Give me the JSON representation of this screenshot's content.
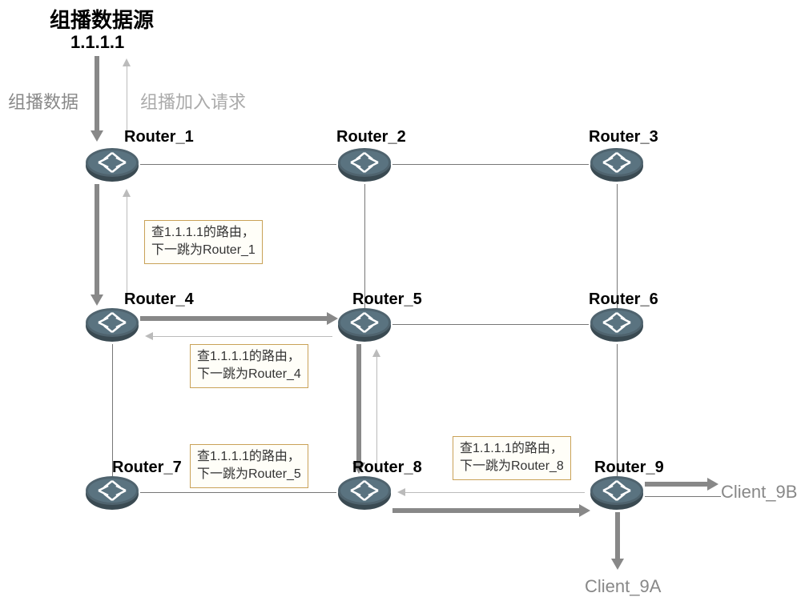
{
  "source": {
    "title": "组播数据源",
    "ip": "1.1.1.1"
  },
  "labels": {
    "multicast_data": "组播数据",
    "join_request": "组播加入请求"
  },
  "routers": {
    "r1": "Router_1",
    "r2": "Router_2",
    "r3": "Router_3",
    "r4": "Router_4",
    "r5": "Router_5",
    "r6": "Router_6",
    "r7": "Router_7",
    "r8": "Router_8",
    "r9": "Router_9"
  },
  "clients": {
    "c9a": "Client_9A",
    "c9b": "Client_9B"
  },
  "notes": {
    "n1": {
      "line1": "查1.1.1.1的路由，",
      "line2": "下一跳为Router_1"
    },
    "n2": {
      "line1": "查1.1.1.1的路由，",
      "line2": "下一跳为Router_4"
    },
    "n3": {
      "line1": "查1.1.1.1的路由，",
      "line2": "下一跳为Router_5"
    },
    "n4": {
      "line1": "查1.1.1.1的路由，",
      "line2": "下一跳为Router_8"
    }
  },
  "diagram": {
    "topology": "3x3 grid of routers",
    "multicast_source_ip": "1.1.1.1",
    "multicast_data_path": [
      "Source",
      "Router_1",
      "Router_4",
      "Router_5",
      "Router_8",
      "Router_9",
      "Client_9A",
      "Client_9B"
    ],
    "join_request_path": [
      "Router_9",
      "Router_8",
      "Router_5",
      "Router_4",
      "Router_1",
      "Source"
    ],
    "route_lookups": [
      {
        "at": "Router_4",
        "lookup": "1.1.1.1",
        "next_hop": "Router_1"
      },
      {
        "at": "Router_5",
        "lookup": "1.1.1.1",
        "next_hop": "Router_4"
      },
      {
        "at": "Router_8",
        "lookup": "1.1.1.1",
        "next_hop": "Router_5"
      },
      {
        "at": "Router_9",
        "lookup": "1.1.1.1",
        "next_hop": "Router_8"
      }
    ]
  }
}
